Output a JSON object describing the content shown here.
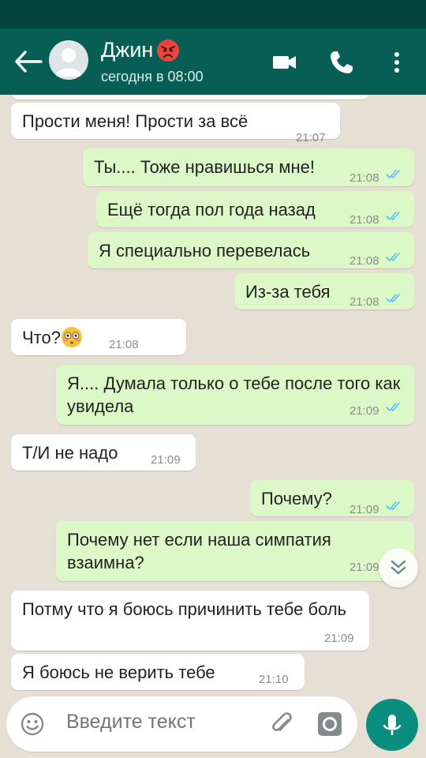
{
  "header": {
    "contact_name": "Джин",
    "last_seen": "сегодня в 08:00"
  },
  "messages": [
    {
      "dir": "in",
      "text": "Прости меня! Прости за всё",
      "time": "21:07"
    },
    {
      "dir": "out",
      "text": "Ты.... Тоже нравишься мне!",
      "time": "21:08",
      "read": true
    },
    {
      "dir": "out",
      "text": "Ещё тогда пол года назад",
      "time": "21:08",
      "read": true
    },
    {
      "dir": "out",
      "text": "Я специально перевелась",
      "time": "21:08",
      "read": true
    },
    {
      "dir": "out",
      "text": "Из-за тебя",
      "time": "21:08",
      "read": true
    },
    {
      "dir": "in",
      "text": "Что?",
      "emoji": "flushed-face-emoji",
      "time": "21:08"
    },
    {
      "dir": "out",
      "text": "Я.... Думала только о тебе после того как увидела",
      "time": "21:09",
      "read": true
    },
    {
      "dir": "in",
      "text": "Т/И не надо",
      "time": "21:09"
    },
    {
      "dir": "out",
      "text": "Почему?",
      "time": "21:09",
      "read": true
    },
    {
      "dir": "out",
      "text": "Почему нет если наша симпатия взаимна?",
      "time": "21:09",
      "read": true
    },
    {
      "dir": "in",
      "text": "Потму что я боюсь причинить тебе боль",
      "time": "21:09"
    },
    {
      "dir": "in",
      "text": "Я боюсь не верить тебе",
      "time": "21:10"
    }
  ],
  "input": {
    "placeholder": "Введите текст"
  },
  "colors": {
    "header": "#075e54",
    "status_bar": "#04433d",
    "outgoing_bubble": "#dcf8c6",
    "incoming_bubble": "#ffffff",
    "read_ticks": "#4fc3f7",
    "mic_button": "#0a8d7e"
  },
  "icons": [
    "back-arrow-icon",
    "avatar-icon",
    "angry-face-emoji",
    "video-call-icon",
    "phone-call-icon",
    "more-options-icon",
    "double-check-icon",
    "scroll-down-icon",
    "emoji-icon",
    "attach-icon",
    "camera-icon",
    "mic-icon"
  ]
}
